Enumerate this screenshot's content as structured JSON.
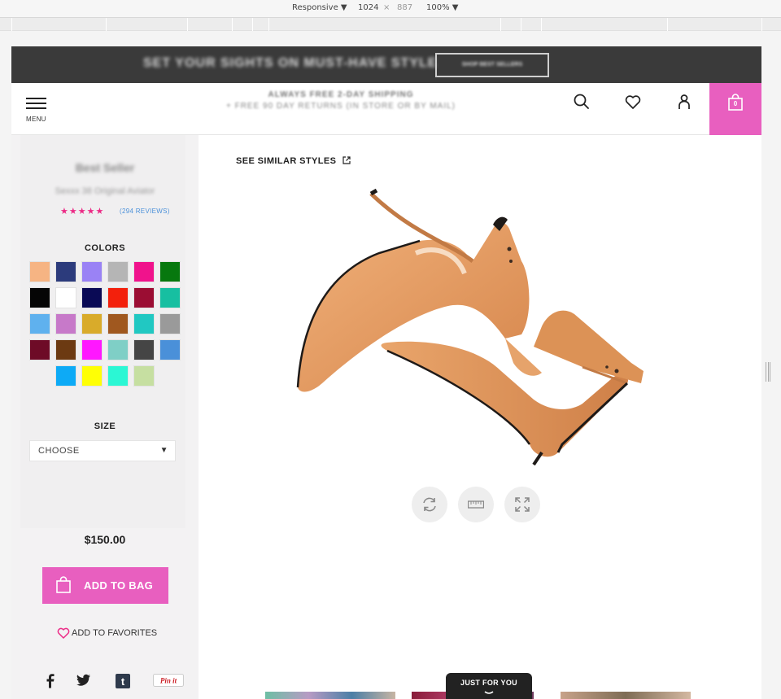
{
  "devtools": {
    "mode": "Responsive",
    "width": "1024",
    "times": "×",
    "height": "887",
    "zoom": "100%"
  },
  "promo": {
    "text": "SET YOUR SIGHTS ON MUST-HAVE STYLE",
    "button": "SHOP BEST SELLERS"
  },
  "header": {
    "menu_label": "MENU",
    "shipping_line1": "ALWAYS FREE 2-DAY SHIPPING",
    "shipping_line2": "+ FREE 90 DAY RETURNS (IN STORE OR BY MAIL)",
    "bag_count": "0",
    "icons": [
      "search-icon",
      "heart-icon",
      "account-icon",
      "bag-icon"
    ],
    "accent": "#e85fbf"
  },
  "product": {
    "brand": "Best Seller",
    "name": "Sexxx 38 Original Aviator",
    "rating_stars": "★★★★★",
    "rating_value": 5,
    "reviews": "(294 REVIEWS)",
    "colors_label": "COLORS",
    "swatches": [
      "#f6b483",
      "#2c3b7c",
      "#9a82f5",
      "#b5b5b5",
      "#f0138c",
      "#07780e",
      "#050505",
      "#ffffff",
      "#0a0a55",
      "#f3200c",
      "#9b0d33",
      "#17bfa1",
      "#5fb1ee",
      "#c779c9",
      "#d9ab2a",
      "#a0581f",
      "#21c8c2",
      "#9a9a9a",
      "#6e0b27",
      "#6c3a12",
      "#ff17ff",
      "#7fcfc6",
      "#454545",
      "#4a90d9",
      "#0daaf6",
      "#ffff05",
      "#2bf7d4",
      "#c6dfa1"
    ],
    "size_label": "SIZE",
    "size_value": "CHOOSE",
    "price": "$150.00",
    "add_to_bag": "ADD TO BAG",
    "add_to_favorites": "ADD TO FAVORITES",
    "social": [
      "facebook-icon",
      "twitter-icon",
      "tumblr-icon",
      "pinterest-icon"
    ],
    "pinterest_label": "Pin it",
    "tumblr_label": "t"
  },
  "gallery": {
    "see_similar": "SEE SIMILAR STYLES",
    "controls": [
      "rotate-icon",
      "ruler-icon",
      "expand-icon"
    ],
    "just_for_you": "JUST FOR YOU"
  }
}
